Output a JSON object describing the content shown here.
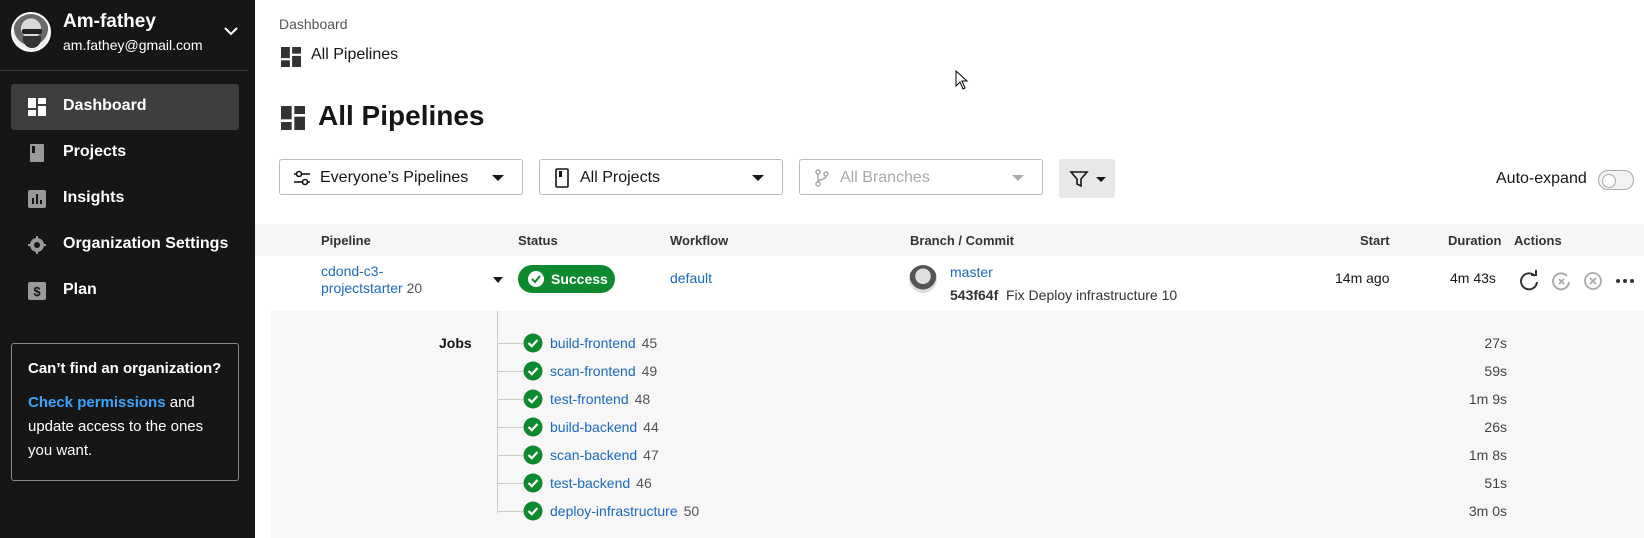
{
  "sidebar": {
    "user": {
      "name": "Am-fathey",
      "email": "am.fathey@gmail.com"
    },
    "items": [
      {
        "label": "Dashboard",
        "icon": "dashboard-icon",
        "active": true
      },
      {
        "label": "Projects",
        "icon": "book-icon"
      },
      {
        "label": "Insights",
        "icon": "bar-chart-icon"
      },
      {
        "label": "Organization Settings",
        "icon": "gear-icon"
      },
      {
        "label": "Plan",
        "icon": "dollar-icon"
      }
    ],
    "help": {
      "title": "Can’t find an organization?",
      "link": "Check permissions",
      "text_after": " and update access to the ones you want."
    }
  },
  "breadcrumb": {
    "parent": "Dashboard",
    "current": "All Pipelines"
  },
  "page_title": "All Pipelines",
  "filters": {
    "pipelines": "Everyone’s Pipelines",
    "projects": "All Projects",
    "branches": "All Branches",
    "auto_expand": "Auto-expand"
  },
  "table": {
    "headers": [
      "Pipeline",
      "Status",
      "Workflow",
      "Branch / Commit",
      "Start",
      "Duration",
      "Actions"
    ],
    "pipeline": {
      "name": "cdond-c3-projectstarter",
      "number": "20",
      "status": "Success",
      "workflow": "default",
      "branch": "master",
      "sha": "543f64f",
      "commit_message": "Fix Deploy infrastructure 10",
      "start": "14m ago",
      "duration": "4m 43s"
    },
    "jobs_label": "Jobs",
    "jobs": [
      {
        "name": "build-frontend",
        "number": "45",
        "duration": "27s"
      },
      {
        "name": "scan-frontend",
        "number": "49",
        "duration": "59s"
      },
      {
        "name": "test-frontend",
        "number": "48",
        "duration": "1m 9s"
      },
      {
        "name": "build-backend",
        "number": "44",
        "duration": "26s"
      },
      {
        "name": "scan-backend",
        "number": "47",
        "duration": "1m 8s"
      },
      {
        "name": "test-backend",
        "number": "46",
        "duration": "51s"
      },
      {
        "name": "deploy-infrastructure",
        "number": "50",
        "duration": "3m 0s"
      }
    ]
  },
  "colors": {
    "success": "#0d8a30",
    "link": "#1a69c4",
    "sidebar_bg": "#161616"
  }
}
